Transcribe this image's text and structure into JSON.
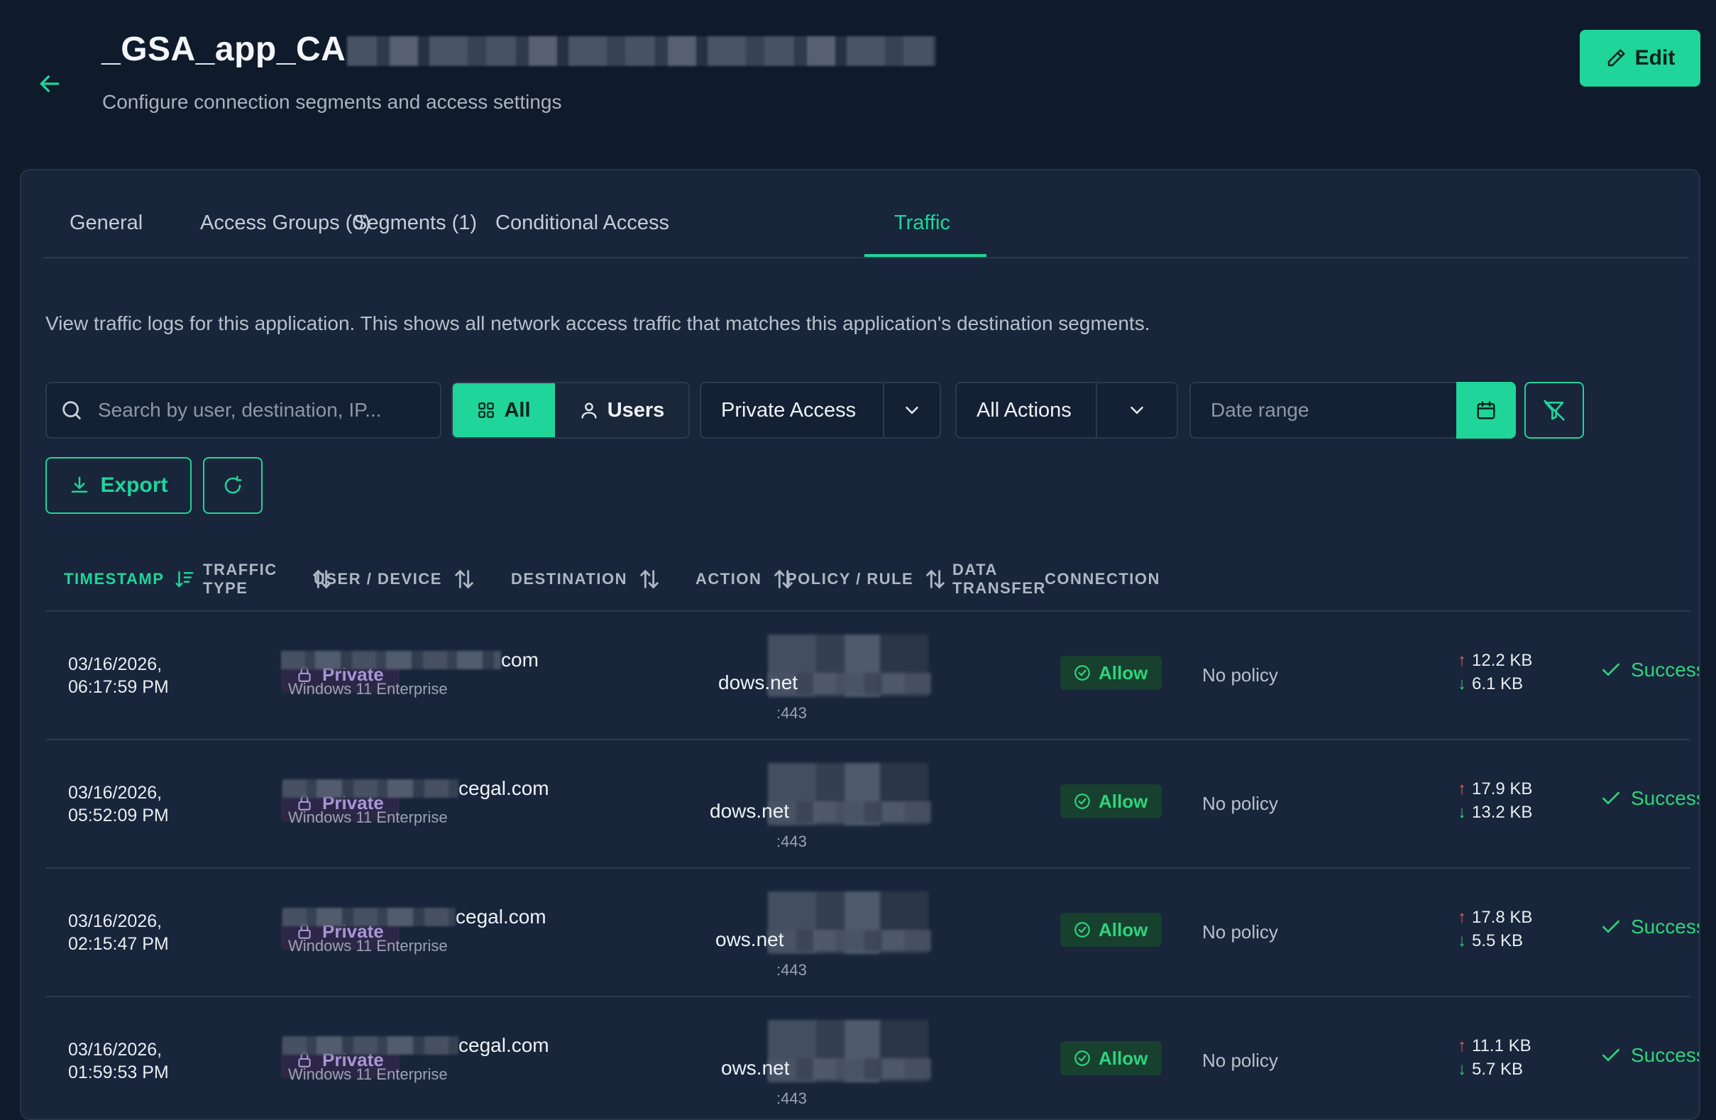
{
  "header": {
    "title": "_GSA_app_CA",
    "subtitle": "Configure connection segments and access settings",
    "edit_label": "Edit"
  },
  "tabs": [
    {
      "label": "General"
    },
    {
      "label": "Access Groups (0)"
    },
    {
      "label": "Segments (1)"
    },
    {
      "label": "Conditional Access"
    },
    {
      "label": "Traffic",
      "active": true
    }
  ],
  "description": "View traffic logs for this application. This shows all network access traffic that matches this application's destination segments.",
  "toolbar": {
    "search_placeholder": "Search by user, destination, IP...",
    "all_label": "All",
    "users_label": "Users",
    "traffic_filter": "Private Access",
    "action_filter": "All Actions",
    "date_placeholder": "Date range",
    "export_label": "Export"
  },
  "columns": {
    "timestamp": "TIMESTAMP",
    "traffic_type_1": "TRAFFIC",
    "traffic_type_2": "TYPE",
    "user_device": "USER / DEVICE",
    "destination": "DESTINATION",
    "action": "ACTION",
    "policy_rule": "POLICY / RULE",
    "data_transfer_1": "DATA",
    "data_transfer_2": "TRANSFER",
    "connection": "CONNECTION"
  },
  "rows": [
    {
      "date": "03/16/2026,",
      "time": "06:17:59 PM",
      "type": "Private",
      "user_suffix": "com",
      "os": "Windows 11 Enterprise",
      "dest_suffix": "dows.net",
      "port": ":443",
      "action": "Allow",
      "policy": "No policy",
      "up": "12.2 KB",
      "down": "6.1 KB",
      "status": "Success"
    },
    {
      "date": "03/16/2026,",
      "time": "05:52:09 PM",
      "type": "Private",
      "user_suffix": "cegal.com",
      "os": "Windows 11 Enterprise",
      "dest_suffix": "dows.net",
      "port": ":443",
      "action": "Allow",
      "policy": "No policy",
      "up": "17.9 KB",
      "down": "13.2 KB",
      "status": "Success"
    },
    {
      "date": "03/16/2026,",
      "time": "02:15:47 PM",
      "type": "Private",
      "user_suffix": "cegal.com",
      "os": "Windows 11 Enterprise",
      "dest_suffix": "ows.net",
      "port": ":443",
      "action": "Allow",
      "policy": "No policy",
      "up": "17.8 KB",
      "down": "5.5 KB",
      "status": "Success"
    },
    {
      "date": "03/16/2026,",
      "time": "01:59:53 PM",
      "type": "Private",
      "user_suffix": "cegal.com",
      "os": "Windows 11 Enterprise",
      "dest_suffix": "ows.net",
      "port": ":443",
      "action": "Allow",
      "policy": "No policy",
      "up": "11.1 KB",
      "down": "5.7 KB",
      "status": "Success"
    }
  ],
  "colors": {
    "accent": "#1fd59a",
    "background": "#0f1a2b",
    "card": "#18253a",
    "allow": "#2ed37d",
    "private": "#a796d6",
    "upload": "#ef5b4a"
  },
  "icons": {
    "back": "arrow-left-icon",
    "edit": "pencil-icon",
    "search": "search-icon",
    "all": "grid-icon",
    "users": "user-icon",
    "caret": "chevron-down-icon",
    "calendar": "calendar-icon",
    "filter": "filter-clear-icon",
    "export": "download-icon",
    "refresh": "refresh-icon",
    "lock": "lock-icon",
    "allow": "check-circle-icon",
    "success": "check-icon",
    "sort": "sort-icon"
  }
}
